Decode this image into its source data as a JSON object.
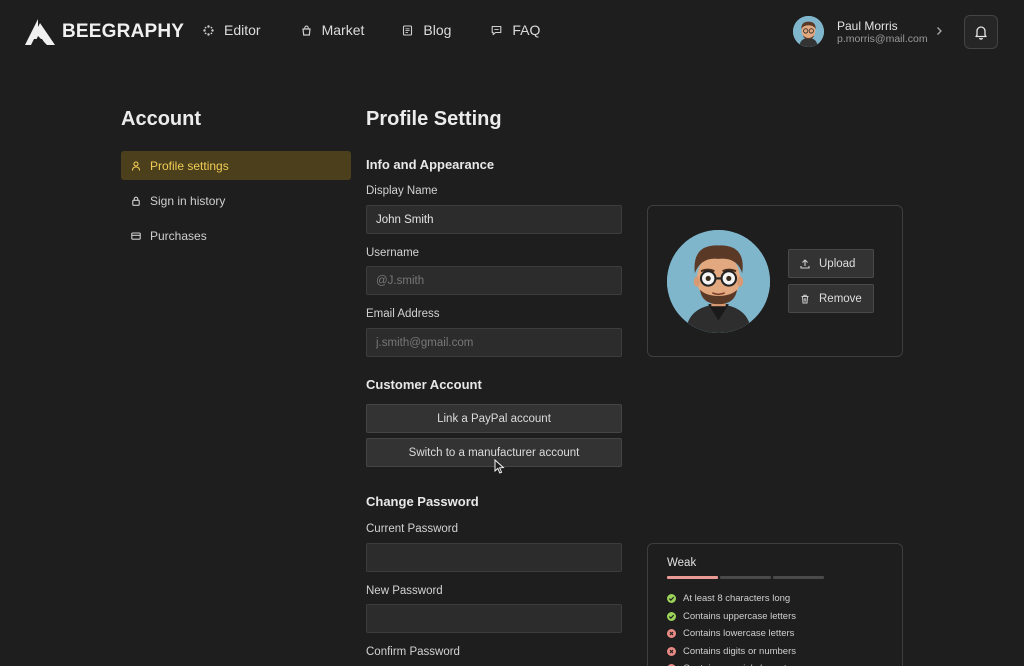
{
  "brand": {
    "name": "BEEGRAPHY"
  },
  "nav": [
    {
      "label": "Editor",
      "icon": "editor-icon"
    },
    {
      "label": "Market",
      "icon": "market-icon"
    },
    {
      "label": "Blog",
      "icon": "blog-icon"
    },
    {
      "label": "FAQ",
      "icon": "faq-icon"
    }
  ],
  "user": {
    "name": "Paul Morris",
    "email": "p.morris@mail.com"
  },
  "sidebar": {
    "title": "Account",
    "items": [
      {
        "label": "Profile settings",
        "icon": "person-icon",
        "active": true
      },
      {
        "label": "Sign in history",
        "icon": "lock-icon",
        "active": false
      },
      {
        "label": "Purchases",
        "icon": "card-icon",
        "active": false
      }
    ]
  },
  "main": {
    "title": "Profile Setting",
    "info": {
      "title": "Info and Appearance",
      "display_name_label": "Display Name",
      "display_name_value": "John Smith",
      "username_label": "Username",
      "username_placeholder": "@J.smith",
      "email_label": "Email Address",
      "email_placeholder": "j.smith@gmail.com"
    },
    "avatar": {
      "upload_label": "Upload",
      "remove_label": "Remove"
    },
    "customer": {
      "title": "Customer Account",
      "paypal_label": "Link a PayPal account",
      "switch_label": "Switch to a manufacturer account"
    },
    "password": {
      "title": "Change Password",
      "current_label": "Current Password",
      "new_label": "New Password",
      "confirm_label": "Confirm Password"
    },
    "strength": {
      "label": "Weak",
      "level": 1,
      "levels_total": 3,
      "rules": [
        {
          "label": "At least 8 characters long",
          "ok": true
        },
        {
          "label": "Contains uppercase letters",
          "ok": true
        },
        {
          "label": "Contains lowercase letters",
          "ok": false
        },
        {
          "label": "Contains digits or numbers",
          "ok": false
        },
        {
          "label": "Contains special characters",
          "ok": false
        }
      ]
    }
  },
  "colors": {
    "accent": "#f2cc55",
    "active_bg": "#4b3f1c",
    "ok": "#9cd35a",
    "fail": "#e98a84",
    "strength_on": "#e99a95"
  }
}
